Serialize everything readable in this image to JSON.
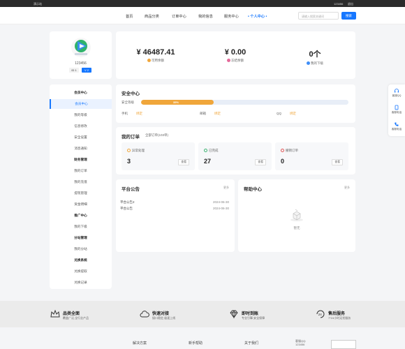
{
  "topbar": {
    "welcome": "演示站",
    "uid": "123456",
    "logout": "退出"
  },
  "nav": {
    "items": [
      "首页",
      "商品分类",
      "订单中心",
      "我的信息",
      "服务中心",
      "• 个人中心 •"
    ],
    "search_placeholder": "请输入搜索关键词",
    "search_button": "搜索"
  },
  "profile": {
    "username": "123456",
    "id_badge": "ID 1",
    "level_badge": "V 2"
  },
  "stats": [
    {
      "value": "¥ 46487.41",
      "label": "可用余额",
      "color": "#f0a63b"
    },
    {
      "value": "¥ 0.00",
      "label": "冻结余额",
      "color": "#e56a9a"
    },
    {
      "value": "0个",
      "label": "我的下级",
      "color": "#3f8ef7"
    }
  ],
  "menu": [
    {
      "label": "会员中心",
      "group": true
    },
    {
      "label": "会员中心",
      "active": true
    },
    {
      "label": "我的等级"
    },
    {
      "label": "信息修改"
    },
    {
      "label": "安全设置"
    },
    {
      "label": "消息通知"
    },
    {
      "label": "财务管理",
      "group": true
    },
    {
      "label": "我的订单"
    },
    {
      "label": "我的充值"
    },
    {
      "label": "提现管理"
    },
    {
      "label": "资金明细"
    },
    {
      "label": "推广中心",
      "group": true
    },
    {
      "label": "我的下级"
    },
    {
      "label": "分站管理",
      "group": true
    },
    {
      "label": "我的分站"
    },
    {
      "label": "兑换系统",
      "group": true
    },
    {
      "label": "兑换提取"
    },
    {
      "label": "兑换记录"
    }
  ],
  "security": {
    "title": "安全中心",
    "level_label": "安全等级",
    "level_percent": 35,
    "level_text": "35%",
    "items": [
      {
        "label": "手机",
        "status": "绑定"
      },
      {
        "label": "邮箱",
        "status": "绑定"
      },
      {
        "label": "QQ",
        "status": "绑定"
      }
    ]
  },
  "orders": {
    "title": "我的订单",
    "subtitle": "全部订单(103单)",
    "boxes": [
      {
        "label": "异常处理",
        "count": "3",
        "view": "查看",
        "color": "#f0a63b"
      },
      {
        "label": "已完成",
        "count": "27",
        "view": "查看",
        "color": "#3cb371"
      },
      {
        "label": "撤销订单",
        "count": "0",
        "view": "查看",
        "color": "#e05555"
      }
    ]
  },
  "notice": {
    "title": "平台公告",
    "more": "更多",
    "rows": [
      {
        "text": "平台公告2",
        "date": "2024-06-30"
      },
      {
        "text": "平台公告",
        "date": "2024-06-30"
      }
    ]
  },
  "help": {
    "title": "帮助中心",
    "more": "更多",
    "empty": "暂无"
  },
  "float_bar": [
    "客服QQ",
    "客服电话",
    "客服电话"
  ],
  "services": [
    {
      "title": "品类全面",
      "desc": "覆盖广泛,全行业产品"
    },
    {
      "title": "快速对接",
      "desc": "接口稳定,极速上线"
    },
    {
      "title": "即时到账",
      "desc": "专业引擎,安全保障"
    },
    {
      "title": "售后服务",
      "desc": "7*24小时无忧服务"
    }
  ],
  "footer": {
    "links": [
      "解决方案",
      "新手帮助",
      "关于我们"
    ],
    "qq_label": "客服QQ:",
    "qq_value": "123456"
  }
}
